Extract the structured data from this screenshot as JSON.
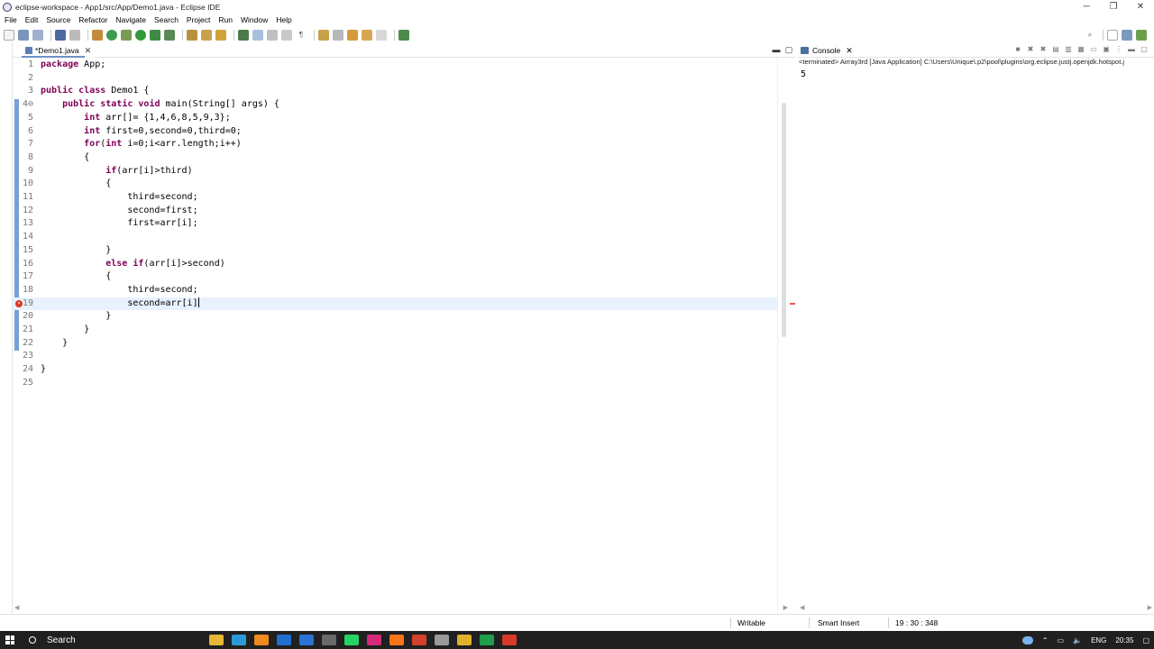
{
  "window": {
    "title": "eclipse-workspace - App1/src/App/Demo1.java - Eclipse IDE",
    "controls": {
      "minimize": "─",
      "maximize": "❐",
      "close": "✕"
    }
  },
  "menu": [
    "File",
    "Edit",
    "Source",
    "Refactor",
    "Navigate",
    "Search",
    "Project",
    "Run",
    "Window",
    "Help"
  ],
  "editor": {
    "tab_label": "*Demo1.java",
    "tab_close": "✕",
    "lines": [
      {
        "n": "1",
        "code": "package App;"
      },
      {
        "n": "2",
        "code": ""
      },
      {
        "n": "3",
        "code": "public class Demo1 {"
      },
      {
        "n": "4⊖",
        "code": "    public static void main(String[] args) {"
      },
      {
        "n": "5",
        "code": "        int arr[]= {1,4,6,8,5,9,3};"
      },
      {
        "n": "6",
        "code": "        int first=0,second=0,third=0;"
      },
      {
        "n": "7",
        "code": "        for(int i=0;i<arr.length;i++)"
      },
      {
        "n": "8",
        "code": "        {"
      },
      {
        "n": "9",
        "code": "            if(arr[i]>third)"
      },
      {
        "n": "10",
        "code": "            {"
      },
      {
        "n": "11",
        "code": "                third=second;"
      },
      {
        "n": "12",
        "code": "                second=first;"
      },
      {
        "n": "13",
        "code": "                first=arr[i];"
      },
      {
        "n": "14",
        "code": ""
      },
      {
        "n": "15",
        "code": "            }"
      },
      {
        "n": "16",
        "code": "            else if(arr[i]>second)"
      },
      {
        "n": "17",
        "code": "            {"
      },
      {
        "n": "18",
        "code": "                third=second;"
      },
      {
        "n": "19",
        "code": "                second=arr[i]"
      },
      {
        "n": "20",
        "code": "            }"
      },
      {
        "n": "21",
        "code": "        }"
      },
      {
        "n": "22",
        "code": "    }"
      },
      {
        "n": "23",
        "code": ""
      },
      {
        "n": "24",
        "code": "}"
      },
      {
        "n": "25",
        "code": ""
      }
    ],
    "current_line": 19,
    "error_line": 19
  },
  "console": {
    "tab_label": "Console",
    "tab_close": "✕",
    "status": "<terminated> Airray3rd [Java Application] C:\\Users\\Unique\\.p2\\pool\\plugins\\org.eclipse.justj.openjdk.hotspot.j",
    "output": "5"
  },
  "statusbar": {
    "mode": "Writable",
    "insert": "Smart Insert",
    "position": "19 : 30 : 348"
  },
  "taskbar": {
    "search": "Search",
    "lang": "ENG",
    "time": "20:35",
    "apps": [
      {
        "name": "file-explorer-icon",
        "color": "#e8b636"
      },
      {
        "name": "edge-icon",
        "color": "#2c9ad8"
      },
      {
        "name": "vlc-icon",
        "color": "#f08a1a"
      },
      {
        "name": "mail-icon",
        "color": "#1f6fcc"
      },
      {
        "name": "calendar-icon",
        "color": "#2a72d4"
      },
      {
        "name": "media-icon",
        "color": "#6a6a6a"
      },
      {
        "name": "whatsapp-icon",
        "color": "#25d366"
      },
      {
        "name": "instagram-icon",
        "color": "#d6297a"
      },
      {
        "name": "firefox-icon",
        "color": "#f5761a"
      },
      {
        "name": "pdf-icon",
        "color": "#d4402c"
      },
      {
        "name": "settings-icon",
        "color": "#9a9a9a"
      },
      {
        "name": "chrome-icon",
        "color": "#e2b12c"
      },
      {
        "name": "camtasia-icon",
        "color": "#1e9e4a"
      },
      {
        "name": "recorder-icon",
        "color": "#d83a2a"
      }
    ]
  }
}
